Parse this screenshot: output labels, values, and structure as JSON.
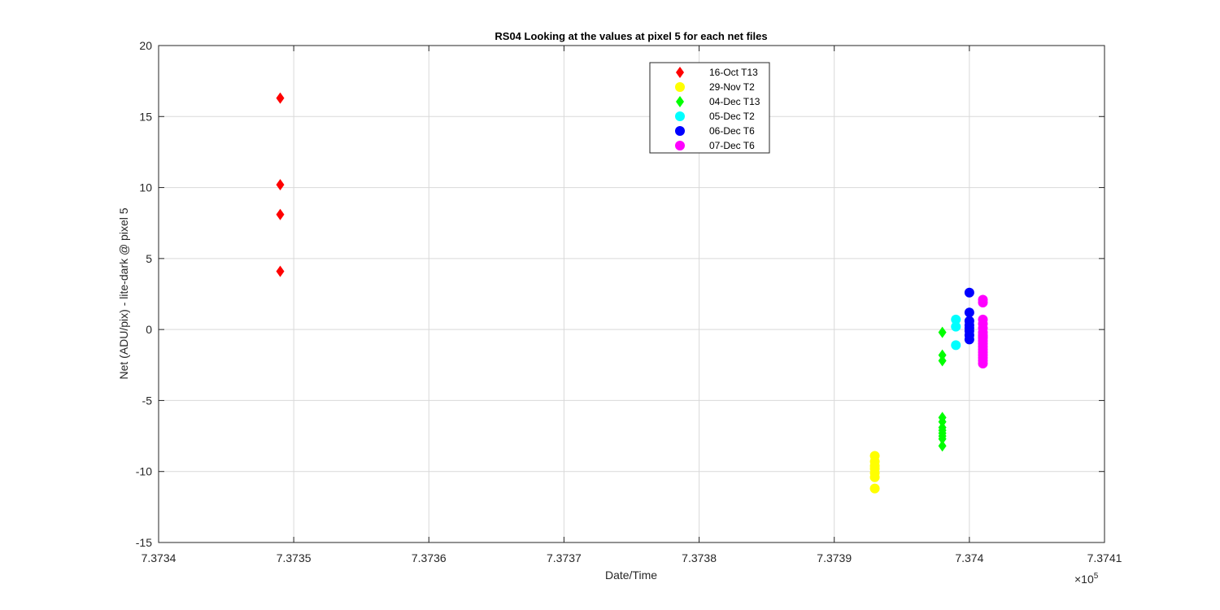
{
  "chart_data": {
    "type": "scatter",
    "title": "RS04  Looking at the values at pixel 5 for each net files",
    "xlabel": "Date/Time",
    "ylabel": "Net (ADU/pix) - lite-dark @ pixel 5",
    "x_exponent_base": "×10",
    "x_exponent_power": "5",
    "xlim": [
      7.3734,
      7.3741
    ],
    "ylim": [
      -15,
      20
    ],
    "x_ticks": [
      "7.3734",
      "7.3735",
      "7.3736",
      "7.3737",
      "7.3738",
      "7.3739",
      "7.374",
      "7.3741"
    ],
    "y_ticks": [
      "-15",
      "-10",
      "-5",
      "0",
      "5",
      "10",
      "15",
      "20"
    ],
    "x_tick_values": [
      7.3734,
      7.3735,
      7.3736,
      7.3737,
      7.3738,
      7.3739,
      7.374,
      7.3741
    ],
    "y_tick_values": [
      -15,
      -10,
      -5,
      0,
      5,
      10,
      15,
      20
    ],
    "grid": true,
    "legend_position": "top-center",
    "series": [
      {
        "name": "16-Oct T13",
        "color": "#ff0000",
        "marker": "diamond",
        "x": [
          7.37349,
          7.37349,
          7.37349,
          7.37349
        ],
        "y": [
          16.3,
          10.2,
          8.1,
          4.1
        ]
      },
      {
        "name": "29-Nov T2",
        "color": "#ffff00",
        "marker": "circle",
        "x": [
          7.37393,
          7.37393,
          7.37393,
          7.37393,
          7.37393,
          7.37393,
          7.37393
        ],
        "y": [
          -8.9,
          -9.3,
          -9.8,
          -10.1,
          -10.4,
          -11.2,
          -9.6
        ]
      },
      {
        "name": "04-Dec T13",
        "color": "#00ff00",
        "marker": "diamond",
        "x": [
          7.37398,
          7.37398,
          7.37398,
          7.37398,
          7.37398,
          7.37398,
          7.37398,
          7.37398,
          7.37398,
          7.37398,
          7.37398
        ],
        "y": [
          -0.2,
          -1.8,
          -2.2,
          -6.2,
          -6.5,
          -6.9,
          -7.1,
          -7.3,
          -7.5,
          -7.7,
          -8.2
        ]
      },
      {
        "name": "05-Dec T2",
        "color": "#00ffff",
        "marker": "circle",
        "x": [
          7.37399,
          7.37399,
          7.37399
        ],
        "y": [
          0.7,
          0.2,
          -1.1
        ]
      },
      {
        "name": "06-Dec T6",
        "color": "#0000ff",
        "marker": "circle",
        "x": [
          7.374,
          7.374,
          7.374,
          7.374,
          7.374,
          7.374,
          7.374,
          7.374
        ],
        "y": [
          2.6,
          1.2,
          0.6,
          0.3,
          0.1,
          -0.1,
          -0.4,
          -0.7
        ]
      },
      {
        "name": "07-Dec T6",
        "color": "#ff00ff",
        "marker": "circle",
        "x": [
          7.37401,
          7.37401,
          7.37401,
          7.37401,
          7.37401,
          7.37401,
          7.37401,
          7.37401,
          7.37401,
          7.37401,
          7.37401,
          7.37401,
          7.37401,
          7.37401,
          7.37401,
          7.37401,
          7.37401,
          7.37401
        ],
        "y": [
          2.1,
          1.9,
          0.7,
          0.4,
          0.1,
          -0.2,
          -0.4,
          -0.6,
          -0.8,
          -1.0,
          -1.2,
          -1.4,
          -1.6,
          -1.8,
          -2.0,
          -2.2,
          -2.4,
          -0.5
        ]
      }
    ]
  }
}
